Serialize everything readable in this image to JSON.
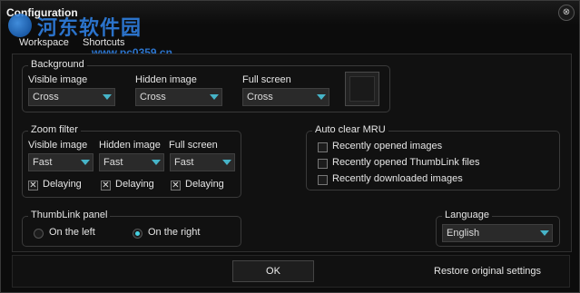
{
  "window": {
    "title": "Configuration",
    "close_glyph": "⊗"
  },
  "watermark": {
    "text": "河东软件园",
    "url": "www.pc0359.cn"
  },
  "tabs": [
    {
      "label": "Workspace"
    },
    {
      "label": "Shortcuts"
    }
  ],
  "background": {
    "legend": "Background",
    "visible": {
      "label": "Visible image",
      "value": "Cross"
    },
    "hidden": {
      "label": "Hidden image",
      "value": "Cross"
    },
    "fullscreen": {
      "label": "Full screen",
      "value": "Cross"
    }
  },
  "zoom": {
    "legend": "Zoom filter",
    "visible": {
      "label": "Visible image",
      "value": "Fast",
      "delay_label": "Delaying",
      "delay_checked": true
    },
    "hidden": {
      "label": "Hidden image",
      "value": "Fast",
      "delay_label": "Delaying",
      "delay_checked": true
    },
    "fullscreen": {
      "label": "Full screen",
      "value": "Fast",
      "delay_label": "Delaying",
      "delay_checked": true
    }
  },
  "mru": {
    "legend": "Auto clear MRU",
    "items": [
      {
        "label": "Recently opened images",
        "checked": false
      },
      {
        "label": "Recently opened ThumbLink files",
        "checked": false
      },
      {
        "label": "Recently downloaded images",
        "checked": false
      }
    ]
  },
  "thumblink": {
    "legend": "ThumbLink panel",
    "left_label": "On the left",
    "right_label": "On the right",
    "selected": "right"
  },
  "language": {
    "legend": "Language",
    "value": "English"
  },
  "footer": {
    "ok_label": "OK",
    "restore_label": "Restore original settings"
  },
  "colors": {
    "accent": "#46b4c8",
    "background": "#0c0c0c"
  }
}
